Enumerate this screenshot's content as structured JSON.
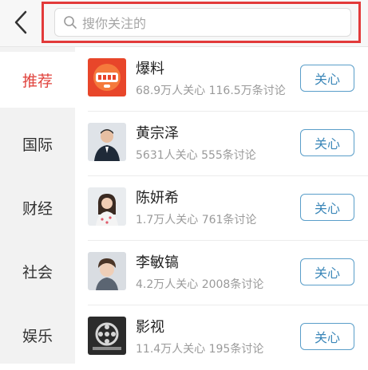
{
  "header": {
    "search_placeholder": "搜你关注的"
  },
  "sidebar": {
    "items": [
      {
        "label": "推荐",
        "active": true
      },
      {
        "label": "国际",
        "active": false
      },
      {
        "label": "财经",
        "active": false
      },
      {
        "label": "社会",
        "active": false
      },
      {
        "label": "娱乐",
        "active": false
      }
    ]
  },
  "list": {
    "items": [
      {
        "name": "爆料",
        "stats": "68.9万人关心 116.5万条讨论",
        "button": "关心",
        "avatar": "bao-liao-logo"
      },
      {
        "name": "黄宗泽",
        "stats": "5631人关心 555条讨论",
        "button": "关心",
        "avatar": "person-photo"
      },
      {
        "name": "陈妍希",
        "stats": "1.7万人关心 761条讨论",
        "button": "关心",
        "avatar": "person-photo"
      },
      {
        "name": "李敏镐",
        "stats": "4.2万人关心 2008条讨论",
        "button": "关心",
        "avatar": "person-photo"
      },
      {
        "name": "影视",
        "stats": "11.4万人关心 195条讨论",
        "button": "关心",
        "avatar": "film-reel-logo"
      }
    ]
  },
  "colors": {
    "accent_red": "#e0443e",
    "button_blue": "#3a86b8",
    "highlight_box": "#e23a3a"
  }
}
